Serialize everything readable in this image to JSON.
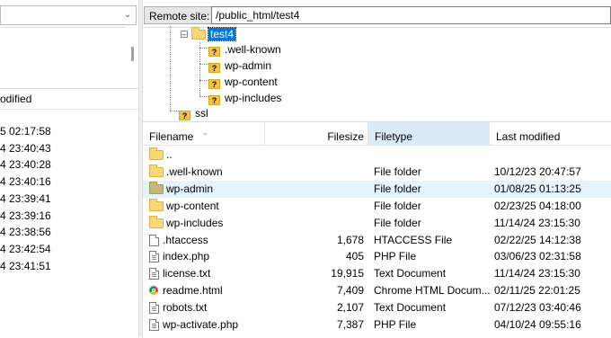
{
  "local": {
    "path_value": "",
    "column_header_partial": "odified",
    "rows": [
      "5 02:17:58",
      "4 23:40:43",
      "4 23:40:28",
      "4 23:40:16",
      "4 23:39:41",
      "4 23:39:16",
      "4 23:38:56",
      "4 23:42:54",
      "4 23:41:51"
    ]
  },
  "remote": {
    "label": "Remote site:",
    "path": "/public_html/test4",
    "tree": {
      "selected": "test4",
      "children": [
        ".well-known",
        "wp-admin",
        "wp-content",
        "wp-includes"
      ],
      "sibling": "ssl",
      "unknown_marker": "?"
    },
    "columns": {
      "filename": "Filename",
      "filesize": "Filesize",
      "filetype": "Filetype",
      "last_modified": "Last modified"
    },
    "files": [
      {
        "name": "..",
        "size": "",
        "type": "",
        "modified": "",
        "icon": "folder-icon"
      },
      {
        "name": ".well-known",
        "size": "",
        "type": "File folder",
        "modified": "10/12/23 20:47:57",
        "icon": "folder-icon"
      },
      {
        "name": "wp-admin",
        "size": "",
        "type": "File folder",
        "modified": "01/08/25 01:13:25",
        "icon": "folder-icon"
      },
      {
        "name": "wp-content",
        "size": "",
        "type": "File folder",
        "modified": "02/23/25 04:18:00",
        "icon": "folder-icon"
      },
      {
        "name": "wp-includes",
        "size": "",
        "type": "File folder",
        "modified": "11/14/24 23:15:30",
        "icon": "folder-icon"
      },
      {
        "name": ".htaccess",
        "size": "1,678",
        "type": "HTACCESS File",
        "modified": "02/22/25 14:12:38",
        "icon": "file-icon"
      },
      {
        "name": "index.php",
        "size": "405",
        "type": "PHP File",
        "modified": "03/06/23 02:31:58",
        "icon": "php-file-icon"
      },
      {
        "name": "license.txt",
        "size": "19,915",
        "type": "Text Document",
        "modified": "11/14/24 23:15:30",
        "icon": "text-file-icon"
      },
      {
        "name": "readme.html",
        "size": "7,409",
        "type": "Chrome HTML Docum...",
        "modified": "02/11/25 22:01:25",
        "icon": "chrome-html-icon"
      },
      {
        "name": "robots.txt",
        "size": "2,107",
        "type": "Text Document",
        "modified": "07/12/23 03:40:46",
        "icon": "text-file-icon"
      },
      {
        "name": "wp-activate.php",
        "size": "7,387",
        "type": "PHP File",
        "modified": "04/10/24 09:55:16",
        "icon": "php-file-icon"
      }
    ]
  },
  "colors": {
    "selection": "#0078d7",
    "active_column": "#d9ebf9",
    "hover_row": "#e5f3ff",
    "folder": "#f8d775"
  }
}
